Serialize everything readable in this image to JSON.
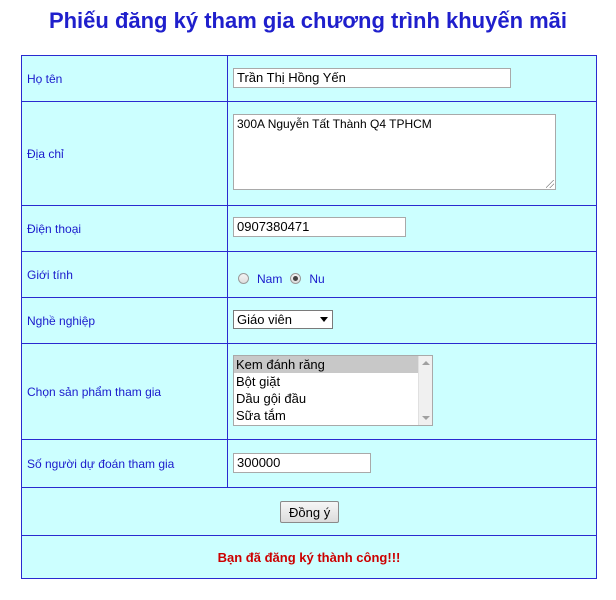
{
  "page": {
    "title": "Phiếu đăng ký tham gia chương trình khuyến mãi"
  },
  "form": {
    "fullname": {
      "label": "Họ tên",
      "value": "Trần Thị Hồng Yến"
    },
    "address": {
      "label": "Địa chỉ",
      "value": "300A Nguyễn Tất Thành Q4 TPHCM"
    },
    "phone": {
      "label": "Điện thoại",
      "value": "0907380471"
    },
    "gender": {
      "label": "Giới tính",
      "options": [
        "Nam",
        "Nu"
      ],
      "selected": "Nu"
    },
    "occupation": {
      "label": "Nghề nghiệp",
      "value": "Giáo viên"
    },
    "products": {
      "label": "Chọn sản phẩm tham gia",
      "items": [
        "Kem đánh răng",
        "Bột giặt",
        "Dầu gội đầu",
        "Sữa tắm"
      ],
      "selected": "Kem đánh răng"
    },
    "prediction": {
      "label": "Số người dự đoán tham gia",
      "value": "300000"
    },
    "submit_label": "Đồng ý",
    "success_message": "Bạn đã đăng ký thành công!!!"
  },
  "colors": {
    "title": "#1f1fcc",
    "table_bg": "#ccffff",
    "border": "#2a2ad0",
    "label_text": "#1a1acc",
    "success_text": "#cc0000"
  },
  "icons": {
    "select_arrow": "chevron-down-icon",
    "scroll_up": "scroll-up-icon",
    "scroll_down": "scroll-down-icon",
    "textarea_resize": "resize-grip-icon"
  }
}
